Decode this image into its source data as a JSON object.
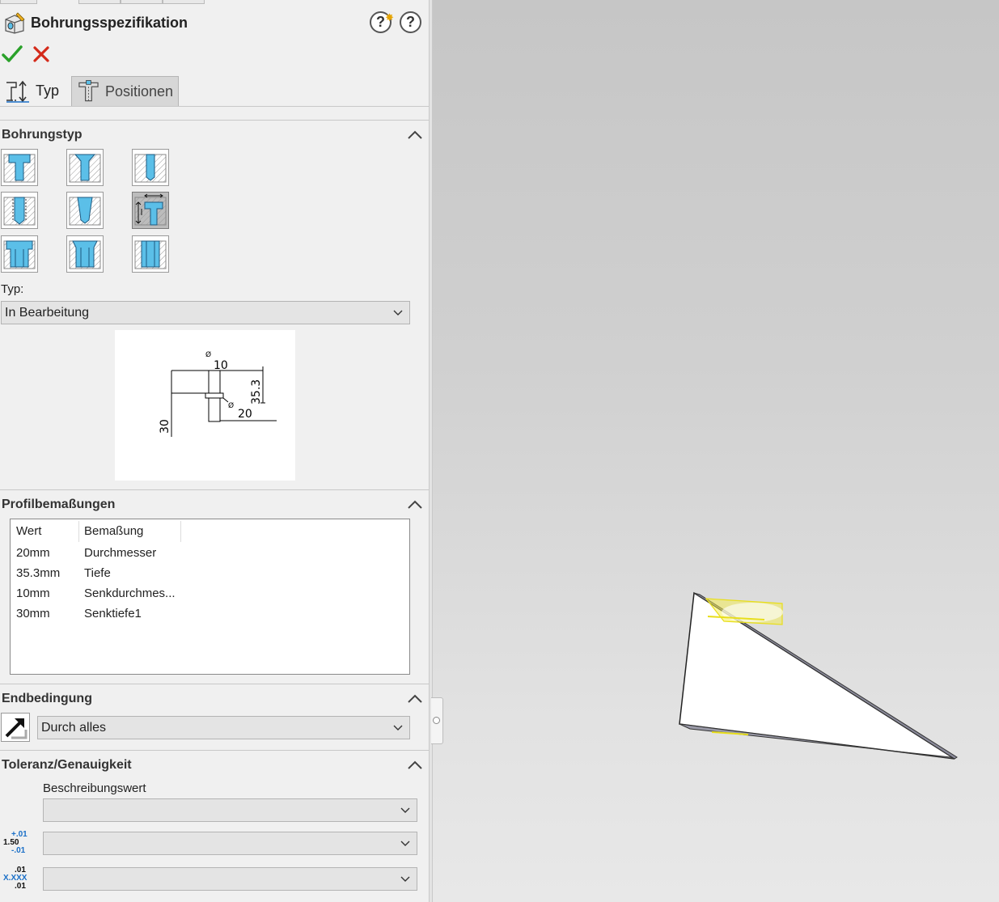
{
  "panel": {
    "title": "Bohrungsspezifikation",
    "tabs": [
      {
        "label": "Typ"
      },
      {
        "label": "Positionen"
      }
    ],
    "sections": {
      "hole_type": {
        "title": "Bohrungstyp"
      },
      "profile": {
        "title": "Profilbemaßungen"
      },
      "end_condition": {
        "title": "Endbedingung"
      },
      "tolerance": {
        "title": "Toleranz/Genauigkeit"
      }
    },
    "type_field": {
      "label": "Typ:",
      "value": "In Bearbeitung"
    },
    "preview": {
      "dims": [
        "10",
        "35.3",
        "20",
        "30"
      ],
      "diameter_symbol": "Ø"
    },
    "profile_table": {
      "columns": [
        "Wert",
        "Bemaßung"
      ],
      "rows": [
        {
          "value": "20mm",
          "dimension": "Durchmesser"
        },
        {
          "value": "35.3mm",
          "dimension": "Tiefe"
        },
        {
          "value": "10mm",
          "dimension": "Senkdurchmes..."
        },
        {
          "value": "30mm",
          "dimension": "Senktiefe1"
        }
      ]
    },
    "end_condition": {
      "value": "Durch alles"
    },
    "tolerance": {
      "label": "Beschreibungswert",
      "tol_icon": {
        "top": "+.01",
        "mid": "1.50",
        "bot": "-.01"
      },
      "prec_icon": {
        "top": ".01",
        "mid": "X.XXX",
        "bot": ".01"
      }
    }
  },
  "icons": {
    "ok": "check-icon",
    "cancel": "close-icon",
    "help": "help-icon",
    "whats_new": "whats-new-help-icon"
  },
  "colors": {
    "ok_green": "#2aa12a",
    "cancel_red": "#d42a1a",
    "hole_blue": "#5bbfe8",
    "highlight_yellow": "#f5ee4a"
  }
}
